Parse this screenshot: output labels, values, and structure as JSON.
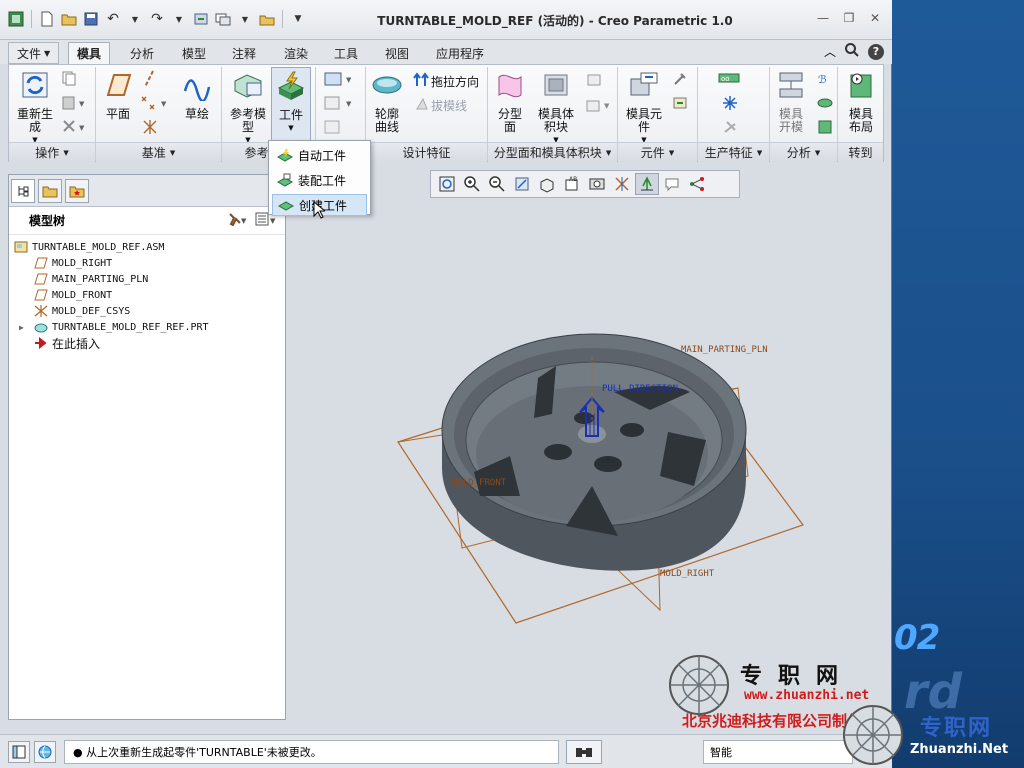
{
  "window": {
    "title": "TURNTABLE_MOLD_REF (活动的) - Creo Parametric 1.0"
  },
  "quick_access": [
    "new-icon",
    "open-icon",
    "save-icon",
    "undo-icon",
    "redo-icon",
    "regenerate-icon",
    "windows-icon",
    "close-window-icon"
  ],
  "tabs": {
    "file": "文件",
    "mold": "模具",
    "analysis": "分析",
    "model": "模型",
    "annotate": "注释",
    "render": "渲染",
    "tools": "工具",
    "view": "视图",
    "apps": "应用程序"
  },
  "ribbon": {
    "regenerate": "重新生成",
    "plane": "平面",
    "sketch": "草绘",
    "ref_model": "参考模型",
    "workpiece": "工件",
    "silhouette": "轮廓曲线",
    "pull_direction": "拖拉方向",
    "draft_line": "拔模线",
    "parting": "分型面",
    "mold_volume": "模具体积块",
    "mold_component": "模具元件",
    "mold_open": "模具开模",
    "mold_layout": "模具布局",
    "groups": {
      "operations": "操作",
      "datum": "基准",
      "ref_model": "参考模型",
      "design_features": "设计特征",
      "parting_volume": "分型面和模具体积块",
      "components": "元件",
      "production": "生产特征",
      "analysis": "分析",
      "goto": "转到"
    }
  },
  "workpiece_menu": {
    "items": [
      "自动工件",
      "装配工件",
      "创建工件"
    ],
    "hover_index": 2
  },
  "model_tree": {
    "title": "模型树",
    "items": [
      {
        "label": "TURNTABLE_MOLD_REF.ASM",
        "icon": "assembly-icon"
      },
      {
        "label": "MOLD_RIGHT",
        "icon": "datum-plane-icon"
      },
      {
        "label": "MAIN_PARTING_PLN",
        "icon": "datum-plane-icon"
      },
      {
        "label": "MOLD_FRONT",
        "icon": "datum-plane-icon"
      },
      {
        "label": "MOLD_DEF_CSYS",
        "icon": "csys-icon"
      },
      {
        "label": "TURNTABLE_MOLD_REF_REF.PRT",
        "icon": "part-icon"
      },
      {
        "label": "在此插入",
        "icon": "insert-arrow-icon"
      }
    ]
  },
  "viewport_labels": {
    "main_parting": "MAIN_PARTING_PLN",
    "pull_direction": "PULL DIRECTION",
    "mold_front": "MOLD_FRONT",
    "mold_right": "MOLD_RIGHT"
  },
  "status": {
    "message": "● 从上次重新生成起零件'TURNTABLE'未被更改。",
    "filter": "智能"
  },
  "watermark": {
    "year": "02",
    "rd": "rd",
    "brand_cn": "专职网",
    "brand_url": "www.zhuanzhi.net",
    "company": "北京兆迪科技有限公司制作",
    "brand2_cn": "专职网",
    "brand2_url": "Zhuanzhi.Net"
  },
  "colors": {
    "datum": "#b0682a",
    "pull_arrow": "#1a2fb4",
    "model_body": "#5d6670"
  }
}
